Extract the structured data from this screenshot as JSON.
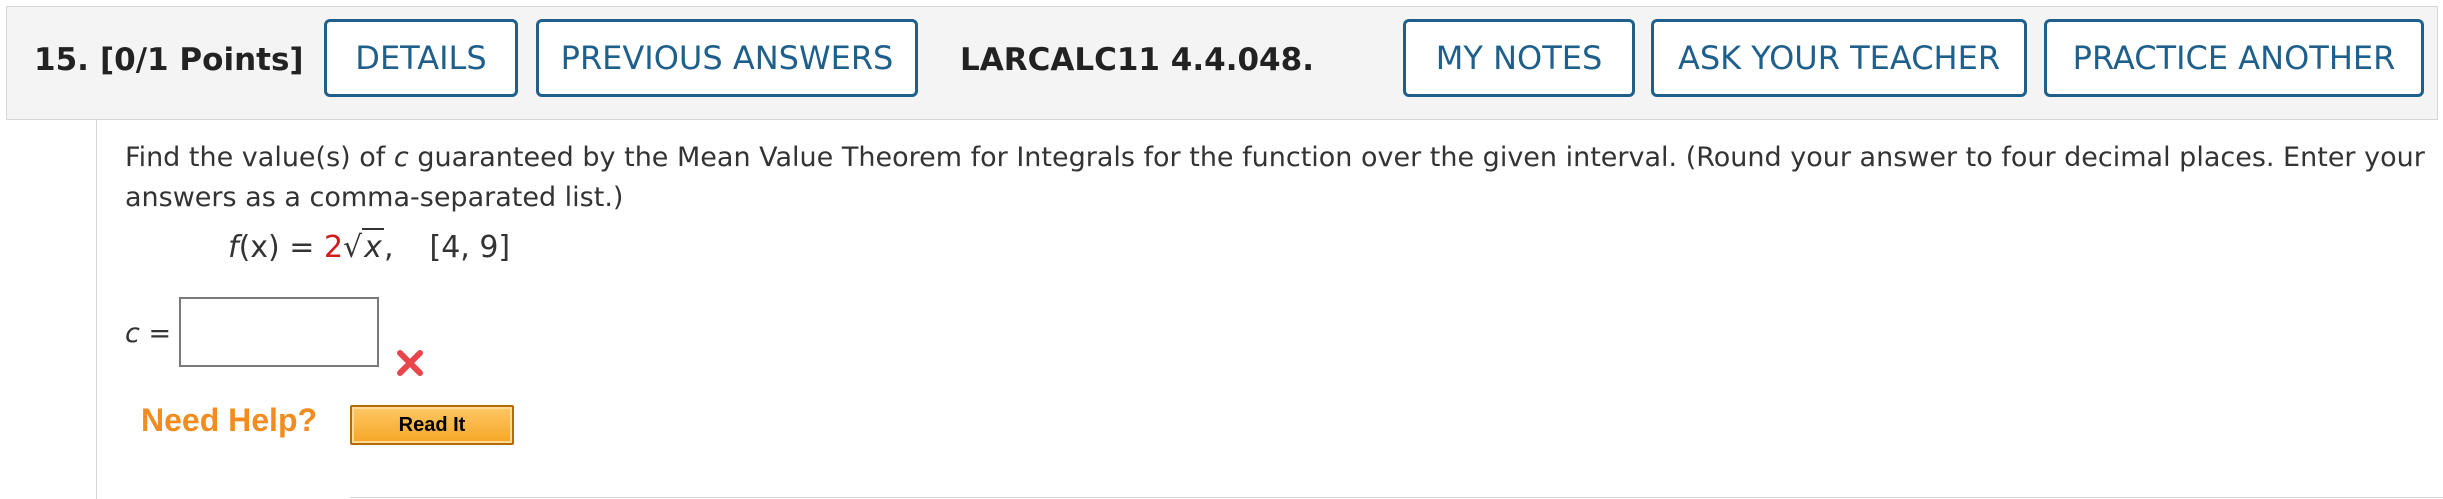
{
  "header": {
    "question_number": "15.",
    "points": "[0/1 Points]",
    "assignment_id": "LARCALC11 4.4.048.",
    "buttons": {
      "details": "DETAILS",
      "previous_answers": "PREVIOUS ANSWERS",
      "my_notes": "MY NOTES",
      "ask_teacher": "ASK YOUR TEACHER",
      "practice_another": "PRACTICE ANOTHER"
    }
  },
  "question": {
    "prompt_before_var": "Find the value(s) of ",
    "prompt_var": "c",
    "prompt_after_var": " guaranteed by the Mean Value Theorem for Integrals for the function over the given interval. (Round your answer to four decimal places. Enter your answers as a comma-separated list.)",
    "formula": {
      "lhs_func": "f",
      "lhs_arg": "(x)",
      "equals": " = ",
      "coefficient": "2",
      "radical_sign": "√",
      "radicand": "x",
      "comma": ",",
      "interval": "[4, 9]"
    },
    "answer_label_var": "c",
    "answer_label_eq": " =",
    "answer_value": "",
    "status": "incorrect",
    "status_color": "#e8464a"
  },
  "help": {
    "need_help": "Need Help?",
    "read_it": "Read It"
  },
  "colors": {
    "button_border": "#1f5f8b",
    "need_help": "#f28c1e",
    "coefficient": "#d11b1b"
  }
}
